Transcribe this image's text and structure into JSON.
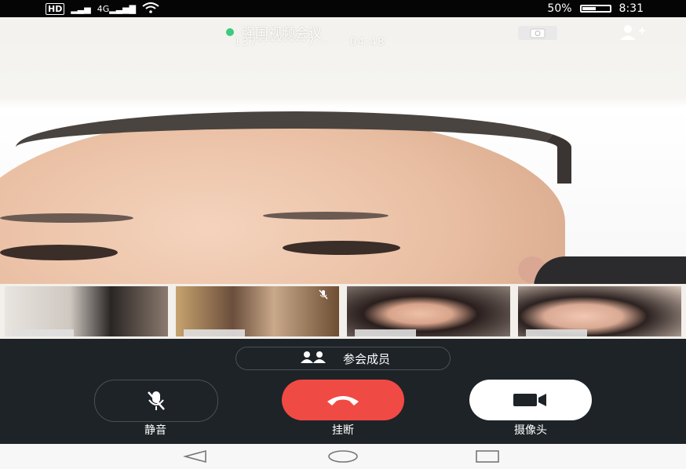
{
  "status_bar": {
    "left_icons": [
      "HD",
      "B",
      "signal",
      "4G",
      "signal",
      "wifi"
    ],
    "battery": "50%",
    "battery_level": 0.5,
    "time": "8:31"
  },
  "call": {
    "title": "强国视频会议",
    "number": "137********7···",
    "duration": "04:48"
  },
  "top_actions": {
    "switch_camera_icon": "camera-switch-icon",
    "add_member_icon": "add-user-icon"
  },
  "thumbnails": [
    {
      "name": "participant-1",
      "muted": false
    },
    {
      "name": "participant-2",
      "muted": true
    },
    {
      "name": "participant-3",
      "muted": false
    },
    {
      "name": "participant-4",
      "muted": false
    }
  ],
  "controls": {
    "members_label": "参会成员",
    "mute_label": "静音",
    "hangup_label": "挂断",
    "camera_label": "摄像头"
  },
  "colors": {
    "control_bg": "#1e2328",
    "hangup": "#f04a44",
    "online": "#1cc46b"
  }
}
